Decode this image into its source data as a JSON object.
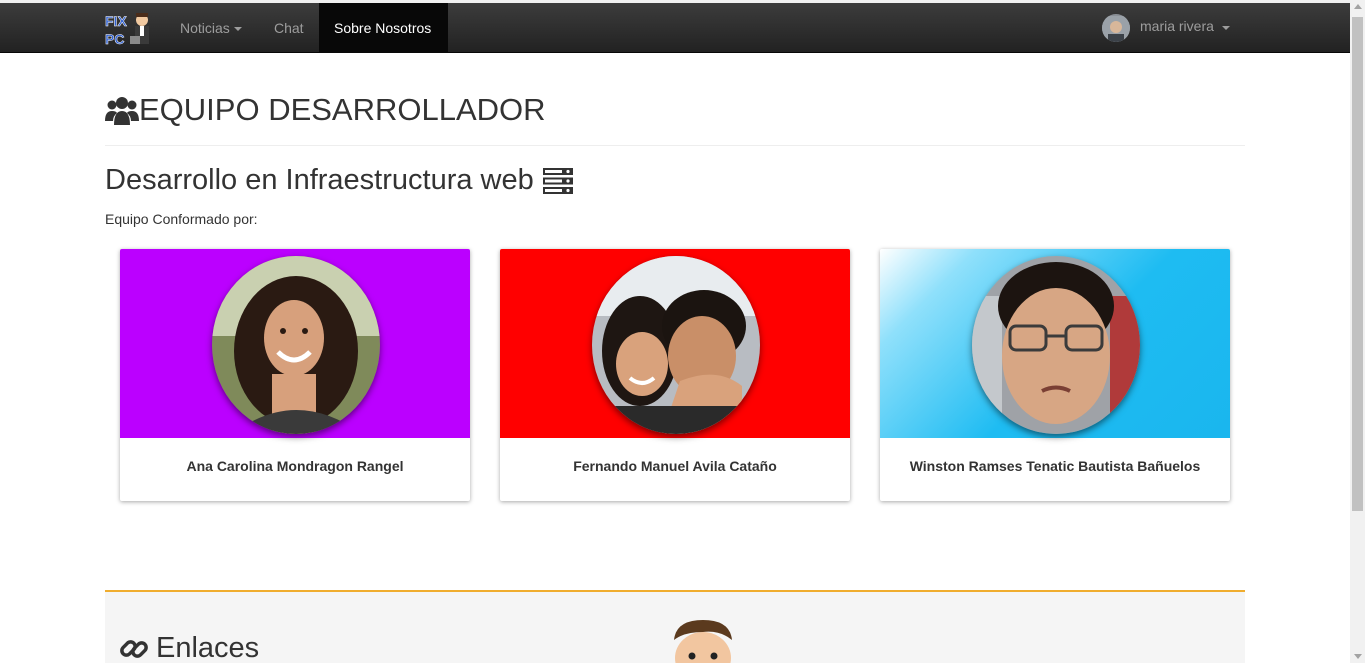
{
  "navbar": {
    "brand_logo": "fix-pc-logo",
    "items": [
      {
        "label": "Noticias",
        "dropdown": true
      },
      {
        "label": "Chat",
        "dropdown": false
      },
      {
        "label": "Sobre Nosotros",
        "dropdown": false,
        "active": true
      }
    ],
    "user": {
      "name": "maria rivera",
      "dropdown": true
    }
  },
  "header": {
    "title": "EQUIPO DESARROLLADOR",
    "icon": "users-icon"
  },
  "section": {
    "title": "Desarrollo en Infraestructura web",
    "icon": "server-icon",
    "subtitle": "Equipo Conformado por:"
  },
  "team": [
    {
      "name": "Ana Carolina Mondragon Rangel",
      "banner_color": "#bb00ff"
    },
    {
      "name": "Fernando Manuel Avila Cataño",
      "banner_color": "#ff0000"
    },
    {
      "name": "Winston Ramses Tenatic Bautista Bañuelos",
      "banner_color": "#33c5f5"
    }
  ],
  "footer": {
    "title": "Enlaces",
    "icon": "link-icon",
    "accent_color": "#f0ad2e"
  },
  "colors": {
    "navbar_bg": "#222222",
    "active_nav_bg": "#080808"
  }
}
